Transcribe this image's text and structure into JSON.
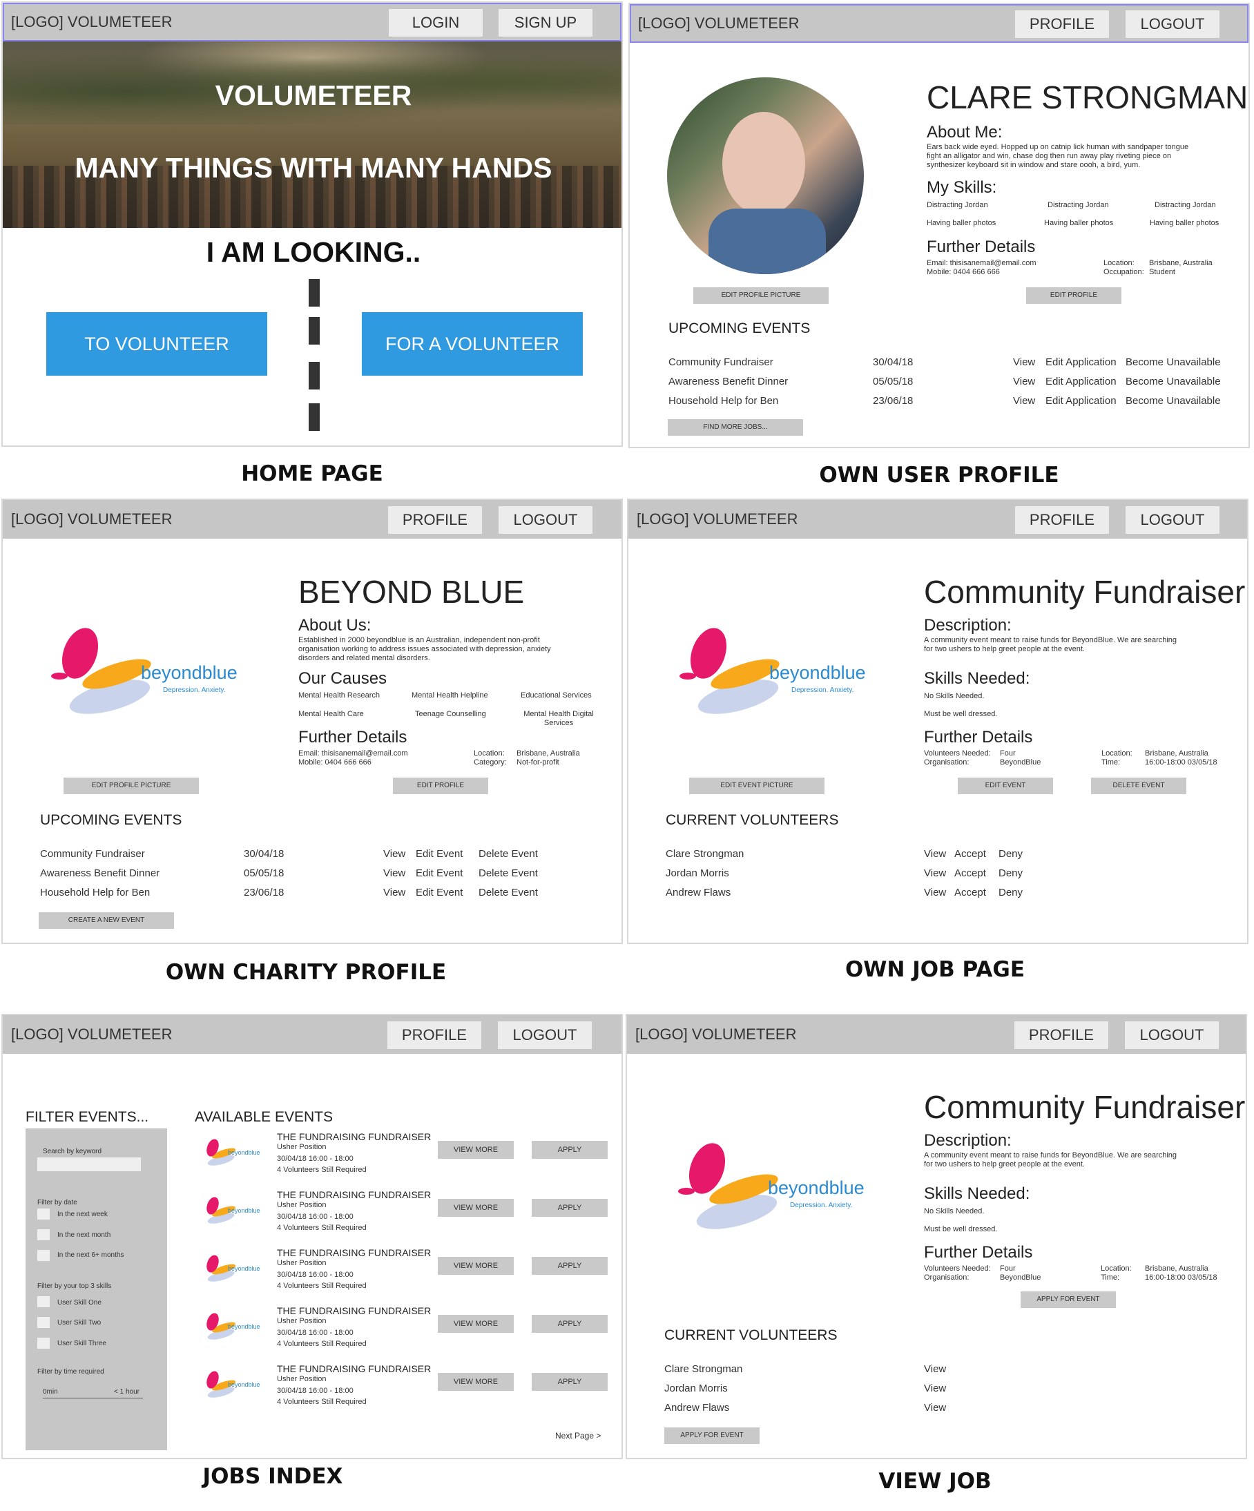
{
  "brand": "[LOGO] VOLUMETEER",
  "nav": {
    "login": "LOGIN",
    "signup": "SIGN UP",
    "profile": "PROFILE",
    "logout": "LOGOUT"
  },
  "home": {
    "hero_title": "VOLUMETEER",
    "hero_tagline": "MANY THINGS WITH MANY HANDS",
    "looking": "I AM LOOKING..",
    "to_volunteer": "TO VOLUNTEER",
    "for_volunteer": "FOR A VOLUNTEER",
    "caption": "HOME PAGE"
  },
  "user_profile": {
    "name": "CLARE STRONGMAN",
    "about_heading": "About Me:",
    "about_text": "Ears back wide eyed. Hopped up on catnip lick human with sandpaper tongue fight an alligator and win, chase dog then run away play riveting piece on synthesizer keyboard sit in window and stare oooh, a bird, yum.",
    "skills_heading": "My Skills:",
    "skills": [
      "Distracting Jordan",
      "Distracting Jordan",
      "Distracting Jordan",
      "Having baller photos",
      "Having baller photos",
      "Having baller photos"
    ],
    "further_heading": "Further Details",
    "email": "Email:  thisisanemail@email.com",
    "mobile": "Mobile: 0404 666 666",
    "location_label": "Location:",
    "location": "Brisbane, Australia",
    "occupation_label": "Occupation:",
    "occupation": "Student",
    "edit_picture": "EDIT PROFILE PICTURE",
    "edit_profile": "EDIT PROFILE",
    "upcoming": "UPCOMING EVENTS",
    "events": [
      {
        "name": "Community Fundraiser",
        "date": "30/04/18"
      },
      {
        "name": "Awareness Benefit Dinner",
        "date": "05/05/18"
      },
      {
        "name": "Household Help for Ben",
        "date": "23/06/18"
      }
    ],
    "view": "View",
    "edit_app": "Edit Application",
    "unavail": "Become Unavailable",
    "find_more": "FIND MORE JOBS...",
    "caption": "OWN USER PROFILE"
  },
  "charity": {
    "name": "BEYOND BLUE",
    "about_heading": "About Us:",
    "about_text": "Established in 2000 beyondblue is an Australian, independent non-profit organisation working to address issues associated with depression, anxiety disorders and related mental disorders.",
    "causes_heading": "Our Causes",
    "causes": [
      "Mental Health Research",
      "Mental Health Helpline",
      "Educational Services",
      "Mental Health Care",
      "Teenage Counselling",
      "Mental Health Digital Services"
    ],
    "further_heading": "Further Details",
    "email": "Email:  thisisanemail@email.com",
    "mobile": "Mobile: 0404 666 666",
    "location_label": "Location:",
    "location": "Brisbane, Australia",
    "category_label": "Category:",
    "category": "Not-for-profit",
    "edit_picture": "EDIT PROFILE PICTURE",
    "edit_profile": "EDIT PROFILE",
    "upcoming": "UPCOMING EVENTS",
    "events": [
      {
        "name": "Community Fundraiser",
        "date": "30/04/18"
      },
      {
        "name": "Awareness Benefit Dinner",
        "date": "05/05/18"
      },
      {
        "name": "Household Help for Ben",
        "date": "23/06/18"
      }
    ],
    "view": "View",
    "edit_event": "Edit Event",
    "delete_event": "Delete Event",
    "create": "CREATE A NEW EVENT",
    "caption": "OWN CHARITY PROFILE"
  },
  "logo": {
    "word": "beyondblue",
    "tag": "Depression. Anxiety."
  },
  "job": {
    "title": "Community Fundraiser",
    "desc_heading": "Description:",
    "desc_text": "A community event meant to raise funds for BeyondBlue. We are searching for two ushers to help greet people at the event.",
    "skills_heading": "Skills Needed:",
    "skill1": "No Skills Needed.",
    "skill2": "Must be well dressed.",
    "further_heading": "Further Details",
    "vol_label": "Volunteers Needed:",
    "vol_value": "Four",
    "org_label": "Organisation:",
    "org_value": "BeyondBlue",
    "loc_label": "Location:",
    "loc_value": "Brisbane, Australia",
    "time_label": "Time:",
    "time_value": "16:00-18:00 03/05/18",
    "edit_picture": "EDIT EVENT PICTURE",
    "edit_event": "EDIT EVENT",
    "delete_event": "DELETE EVENT",
    "volunteers_heading": "CURRENT VOLUNTEERS",
    "volunteers": [
      "Clare Strongman",
      "Jordan Morris",
      "Andrew Flaws"
    ],
    "view": "View",
    "accept": "Accept",
    "deny": "Deny",
    "caption": "OWN JOB PAGE"
  },
  "index": {
    "filter_heading": "FILTER EVENTS...",
    "search_label": "Search by keyword",
    "date_label": "Filter by date",
    "date_opts": [
      "In the next week",
      "In the next month",
      "In the next 6+ months"
    ],
    "skills_label": "Filter by your top 3 skills",
    "skill_opts": [
      "User Skill One",
      "User Skill Two",
      "User Skill Three"
    ],
    "time_label": "Filter by time required",
    "time_min": "0min",
    "time_max": "< 1 hour",
    "available": "AVAILABLE EVENTS",
    "job_title": "THE FUNDRAISING FUNDRAISER",
    "job_position": "Usher Position",
    "job_time": "30/04/18 16:00 - 18:00",
    "job_needed": "4 Volunteers Still Required",
    "view_more": "VIEW MORE",
    "apply": "APPLY",
    "next": "Next Page >",
    "caption": "JOBS INDEX"
  },
  "view_job": {
    "apply_event": "APPLY FOR EVENT",
    "caption": "VIEW JOB"
  }
}
